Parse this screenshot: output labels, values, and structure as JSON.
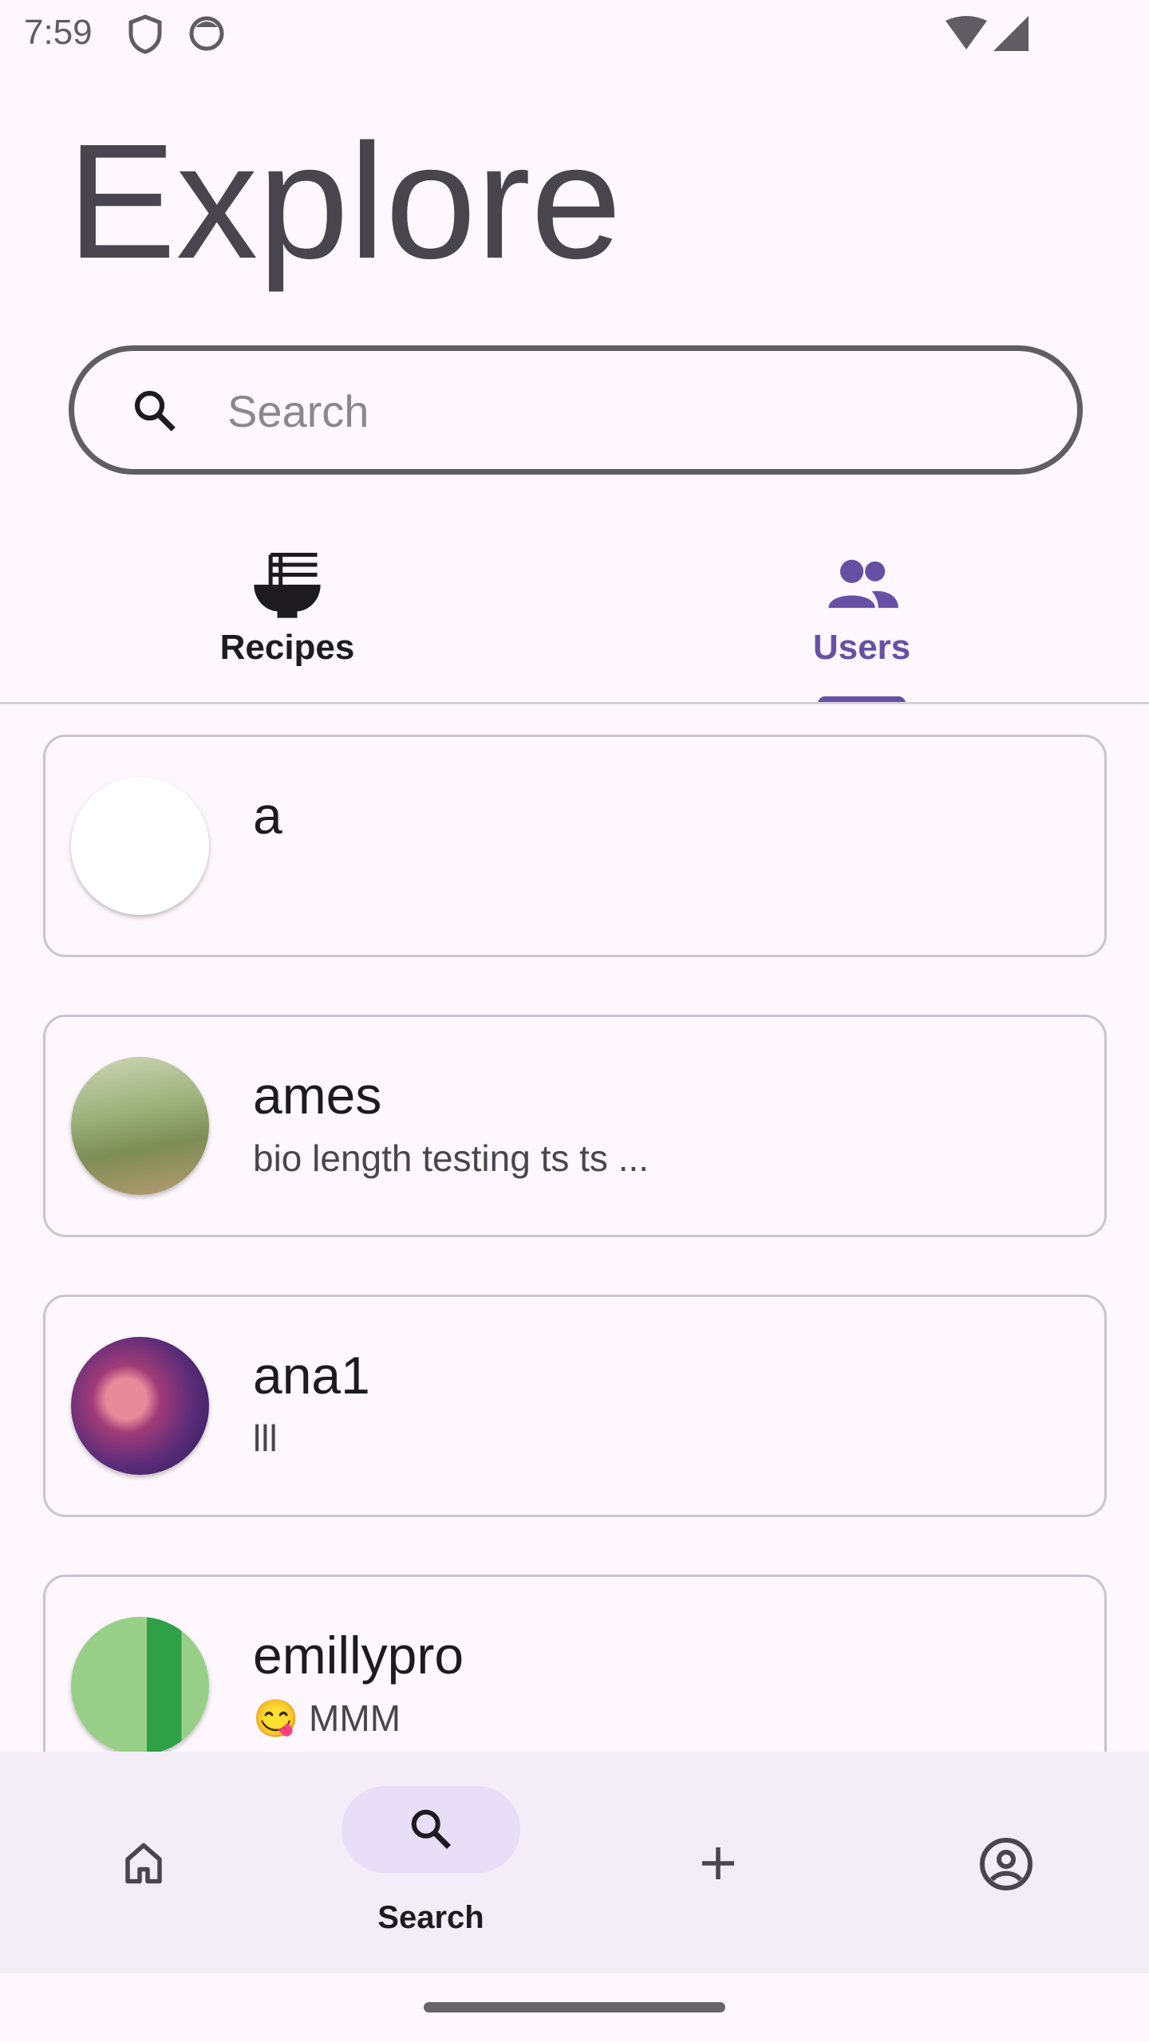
{
  "status_bar": {
    "time": "7:59",
    "icons": [
      "shield-icon",
      "cat-icon",
      "wifi-icon",
      "signal-icon"
    ]
  },
  "header": {
    "title": "Explore"
  },
  "search": {
    "placeholder": "Search",
    "value": ""
  },
  "tabs": [
    {
      "label": "Recipes",
      "icon": "noodle-bowl-icon",
      "selected": false
    },
    {
      "label": "Users",
      "icon": "group-icon",
      "selected": true
    }
  ],
  "colors": {
    "accent": "#6750a4",
    "pill": "#e8def8",
    "nav_bg": "#f3edf7"
  },
  "users": [
    {
      "name": "a",
      "bio": ""
    },
    {
      "name": "ames",
      "bio": "bio length testing ts ts ..."
    },
    {
      "name": "ana1",
      "bio": "lll"
    },
    {
      "name": "emillypro",
      "bio": "😋 MMM"
    }
  ],
  "bottom_nav": [
    {
      "label": "",
      "icon": "home-icon"
    },
    {
      "label": "Search",
      "icon": "search-icon",
      "selected": true
    },
    {
      "label": "",
      "icon": "plus-icon"
    },
    {
      "label": "",
      "icon": "account-circle-icon"
    }
  ]
}
